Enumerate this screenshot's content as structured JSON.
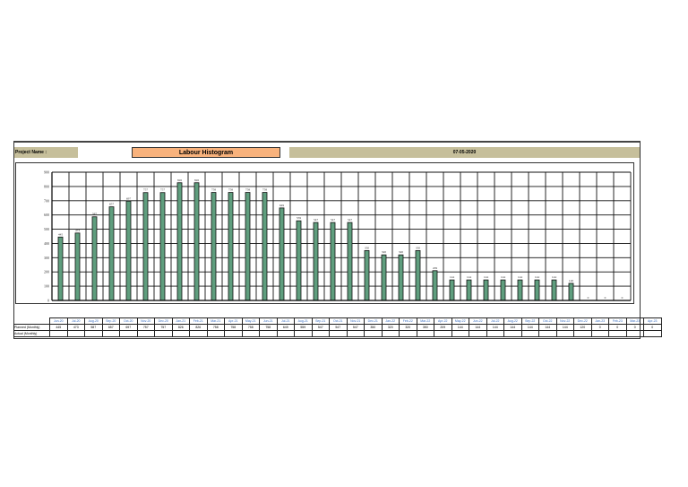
{
  "header": {
    "project_label": "Project Name :",
    "title": "Labour Histogram",
    "date": "07-05-2020"
  },
  "table": {
    "planned_label": "Planned (Monthly)",
    "actual_label": "Actual (Monthly)",
    "months": [
      "Jun-20",
      "Jul-20",
      "Aug-20",
      "Sep-20",
      "Oct-20",
      "Nov-20",
      "Dec-20",
      "Jan-21",
      "Feb-21",
      "Mar-21",
      "Apr-21",
      "May-21",
      "Jun-21",
      "Jul-21",
      "Aug-21",
      "Sep-21",
      "Oct-21",
      "Nov-21",
      "Dec-21",
      "Jan-22",
      "Feb-22",
      "Mar-22",
      "Apr-22",
      "May-22",
      "Jun-22",
      "Jul-22",
      "Aug-22",
      "Sep-22",
      "Oct-22",
      "Nov-22",
      "Dec-22",
      "Jan-23",
      "Feb-23",
      "Mar-23",
      "Apr-23"
    ],
    "planned": [
      "445",
      "473",
      "587",
      "657",
      "697",
      "757",
      "757",
      "826",
      "826",
      "758",
      "758",
      "758",
      "758",
      "649",
      "559",
      "547",
      "547",
      "547",
      "350",
      "320",
      "320",
      "350",
      "209",
      "144",
      "144",
      "144",
      "144",
      "144",
      "144",
      "144",
      "120",
      "0",
      "0",
      "0",
      "0"
    ]
  },
  "chart_data": {
    "type": "bar",
    "title": "Labour Histogram",
    "xlabel": "",
    "ylabel": "",
    "ylim": [
      0,
      900
    ],
    "grid": true,
    "yticks": [
      0,
      100,
      200,
      300,
      400,
      500,
      600,
      700,
      800,
      900
    ],
    "categories": [
      "Jun-20",
      "Jul-20",
      "Aug-20",
      "Sep-20",
      "Oct-20",
      "Nov-20",
      "Dec-20",
      "Jan-21",
      "Feb-21",
      "Mar-21",
      "Apr-21",
      "May-21",
      "Jun-21",
      "Jul-21",
      "Aug-21",
      "Sep-21",
      "Oct-21",
      "Nov-21",
      "Dec-21",
      "Jan-22",
      "Feb-22",
      "Mar-22",
      "Apr-22",
      "May-22",
      "Jun-22",
      "Jul-22",
      "Aug-22",
      "Sep-22",
      "Oct-22",
      "Nov-22",
      "Dec-22",
      "Jan-23",
      "Feb-23",
      "Mar-23"
    ],
    "series": [
      {
        "name": "Planned (Monthly)",
        "color": "#5f9e7e",
        "values": [
          445,
          473,
          587,
          657,
          697,
          757,
          757,
          826,
          826,
          758,
          758,
          758,
          758,
          649,
          559,
          547,
          547,
          547,
          350,
          320,
          320,
          350,
          209,
          144,
          144,
          144,
          144,
          144,
          144,
          144,
          120,
          0,
          0,
          0
        ]
      }
    ]
  }
}
